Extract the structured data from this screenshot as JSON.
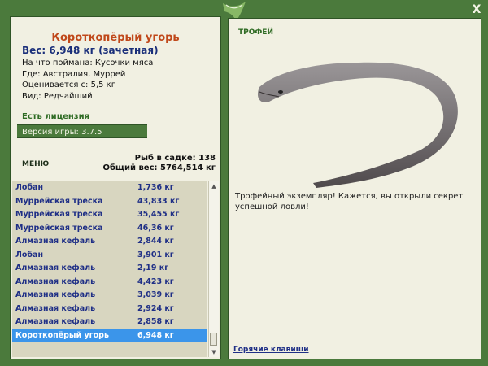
{
  "window": {
    "close_label": "X"
  },
  "fish": {
    "title": "Короткопёрый угорь",
    "weight_line": "Вес: 6,948 кг (зачетная)",
    "bait_line": "На что поймана: Кусочки мяса",
    "place_line": "Где: Австралия, Муррей",
    "valued_line": "Оценивается с: 5,5 кг",
    "kind_line": "Вид: Редчайший"
  },
  "license": "Есть лицензия",
  "version": "Версия игры: 3.7.5",
  "menu_label": "МЕНЮ",
  "cage": {
    "count_line": "Рыб в садке: 138",
    "total_line": "Общий вес: 5764,514 кг"
  },
  "fish_list": [
    {
      "name": "Лобан",
      "weight": "1,736 кг"
    },
    {
      "name": "Муррейская треска",
      "weight": "43,833 кг"
    },
    {
      "name": "Муррейская треска",
      "weight": "35,455 кг"
    },
    {
      "name": "Муррейская треска",
      "weight": "46,36 кг"
    },
    {
      "name": "Алмазная кефаль",
      "weight": "2,844 кг"
    },
    {
      "name": "Лобан",
      "weight": "3,901 кг"
    },
    {
      "name": "Алмазная кефаль",
      "weight": "2,19 кг"
    },
    {
      "name": "Алмазная кефаль",
      "weight": "4,423 кг"
    },
    {
      "name": "Алмазная кефаль",
      "weight": "3,039 кг"
    },
    {
      "name": "Алмазная кефаль",
      "weight": "2,924 кг"
    },
    {
      "name": "Алмазная кефаль",
      "weight": "2,858 кг"
    },
    {
      "name": "Короткопёрый угорь",
      "weight": "6,948 кг"
    }
  ],
  "selected_index": 11,
  "trophy": {
    "label": "ТРОФЕЙ",
    "text": "Трофейный экземпляр! Кажется, вы открыли секрет успешной ловли!"
  },
  "hotkeys_label": "Горячие клавиши",
  "icons": {
    "logo": "fish-logo-icon",
    "close": "close-icon",
    "scroll_up": "arrow-up-icon",
    "scroll_down": "arrow-down-icon"
  },
  "colors": {
    "frame": "#4b7a3c",
    "panel": "#f1f0e2",
    "title": "#c0481a",
    "list_text": "#1f2f86",
    "selected_row": "#3b95ea"
  }
}
